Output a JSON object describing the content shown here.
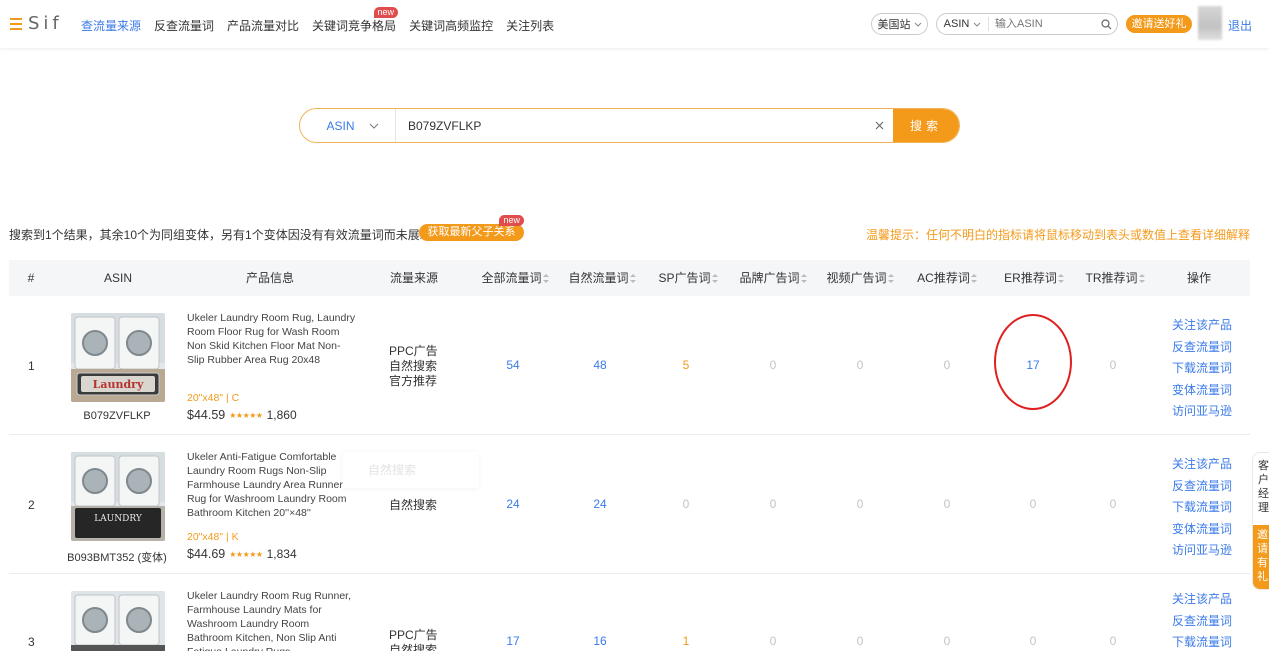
{
  "nav": {
    "logo": "Sif",
    "items": [
      {
        "label": "查流量来源",
        "active": true,
        "badge": ""
      },
      {
        "label": "反查流量词",
        "active": false,
        "badge": ""
      },
      {
        "label": "产品流量对比",
        "active": false,
        "badge": ""
      },
      {
        "label": "关键词竞争格局",
        "active": false,
        "badge": "new"
      },
      {
        "label": "关键词高频监控",
        "active": false,
        "badge": ""
      },
      {
        "label": "关注列表",
        "active": false,
        "badge": ""
      }
    ],
    "site": "美国站",
    "search_type": "ASIN",
    "search_placeholder": "输入ASIN",
    "invite": "邀请送好礼",
    "logout": "退出"
  },
  "search": {
    "type": "ASIN",
    "value": "B079ZVFLKP",
    "button": "搜索"
  },
  "info": {
    "result_text": "搜索到1个结果，其余10个为同组变体，另有1个变体因没有有效流量词而未展示",
    "parent_button": "获取最新父子关系",
    "parent_badge": "new",
    "tip": "温馨提示：任何不明白的指标请将鼠标移动到表头或数值上查看详细解释"
  },
  "table": {
    "headers": {
      "idx": "#",
      "asin": "ASIN",
      "info": "产品信息",
      "source": "流量来源",
      "all": "全部流量词",
      "natural": "自然流量词",
      "sp": "SP广告词",
      "brand": "品牌广告词",
      "video": "视频广告词",
      "ac": "AC推荐词",
      "er": "ER推荐词",
      "tr": "TR推荐词",
      "ops": "操作"
    },
    "rows": [
      {
        "idx": "1",
        "asin": "B079ZVFLKP",
        "title": "Ukeler Laundry Room Rug, Laundry Room Floor Rug for Wash Room Non Skid Kitchen Floor Mat Non-Slip Rubber Area Rug 20x48",
        "variant": "20\"x48\"   |   C",
        "price": "$44.59",
        "stars": "★★★★★",
        "reviews": "1,860",
        "sources": [
          "PPC广告",
          "自然搜索",
          "官方推荐"
        ],
        "all": "54",
        "natural": "48",
        "sp": "5",
        "brand": "0",
        "video": "0",
        "ac": "0",
        "er": "17",
        "tr": "0",
        "mat_text": "Laundry"
      },
      {
        "idx": "2",
        "asin": "B093BMT352 (变体)",
        "title": "Ukeler Anti-Fatigue Comfortable Laundry Room Rugs Non-Slip Farmhouse Laundry Area Runner Rug for Washroom Laundry Room Bathroom Kitchen 20''×48''",
        "variant": "20\"x48\"   |   K",
        "price": "$44.69",
        "stars": "★★★★★",
        "reviews": "1,834",
        "sources": [
          "自然搜索"
        ],
        "all": "24",
        "natural": "24",
        "sp": "0",
        "brand": "0",
        "video": "0",
        "ac": "0",
        "er": "0",
        "tr": "0",
        "mat_text": "LAUNDRY"
      },
      {
        "idx": "3",
        "asin": "",
        "title": "Ukeler Laundry Room Rug Runner, Farmhouse Laundry Mats for Washroom Laundry Room Bathroom Kitchen, Non Slip Anti Fatigue Laundry Rugs",
        "variant": "",
        "price": "",
        "stars": "",
        "reviews": "",
        "sources": [
          "PPC广告",
          "自然搜索"
        ],
        "all": "17",
        "natural": "16",
        "sp": "1",
        "brand": "0",
        "video": "0",
        "ac": "0",
        "er": "0",
        "tr": "0",
        "mat_text": ""
      }
    ],
    "operations": [
      "关注该产品",
      "反查流量词",
      "下载流量词",
      "变体流量词",
      "访问亚马逊"
    ]
  },
  "tooltip": "自然搜索",
  "side_widget": {
    "top": "客户经理",
    "bottom": "邀请有礼"
  },
  "colors": {
    "accent": "#f39a1b",
    "link": "#3b7be8",
    "highlight": "#e02020"
  }
}
